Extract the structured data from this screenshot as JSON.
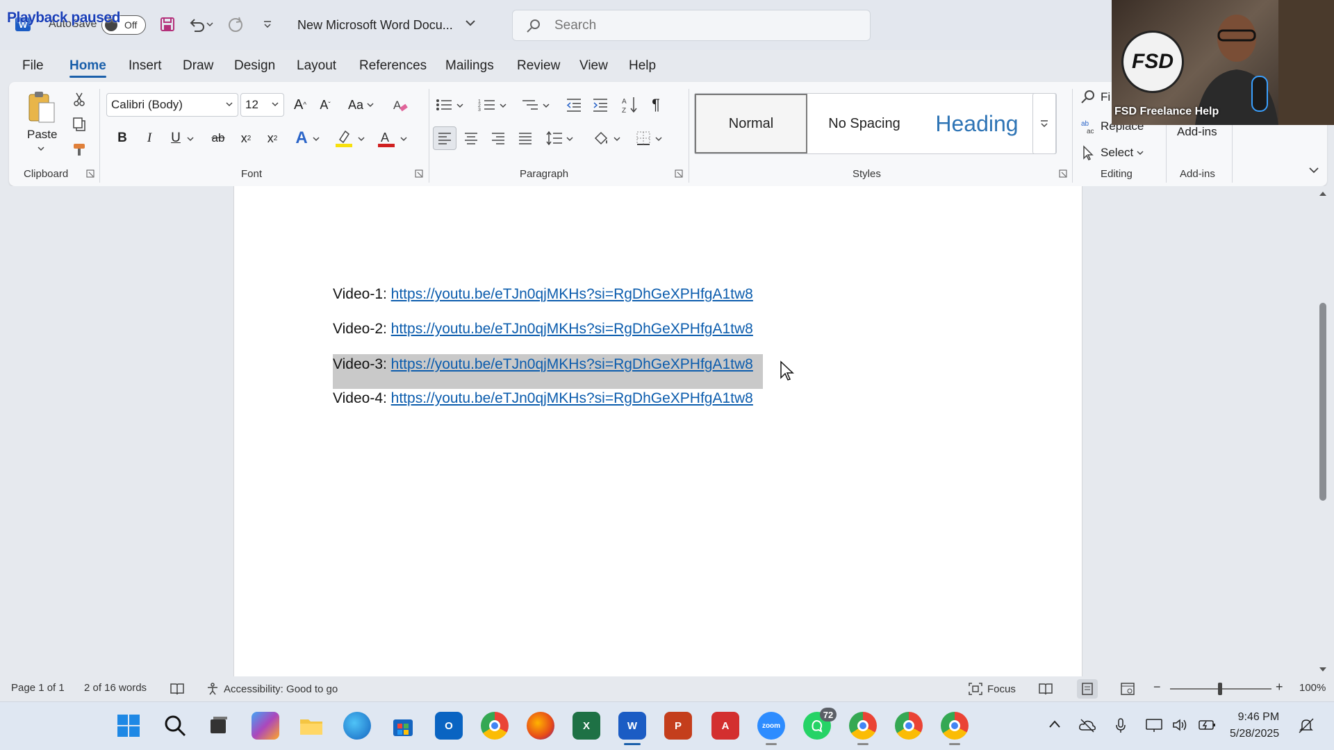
{
  "overlay": {
    "text": "Playback paused"
  },
  "titlebar": {
    "autosave_label": "AutoSave",
    "autosave_state": "Off",
    "doc_title": "New Microsoft Word Docu...",
    "search_placeholder": "Search"
  },
  "webcam": {
    "caption": "FSD Freelance Help",
    "logo_text": "FSD"
  },
  "menu": {
    "tabs": [
      "File",
      "Home",
      "Insert",
      "Draw",
      "Design",
      "Layout",
      "References",
      "Mailings",
      "Review",
      "View",
      "Help"
    ],
    "active": "Home"
  },
  "ribbon": {
    "clipboard": {
      "paste_label": "Paste",
      "group_label": "Clipboard"
    },
    "font": {
      "font_name": "Calibri (Body)",
      "font_size": "12",
      "case_label": "Aa",
      "group_label": "Font"
    },
    "paragraph": {
      "group_label": "Paragraph"
    },
    "styles": {
      "items": [
        "Normal",
        "No Spacing",
        "Heading"
      ],
      "selected": "Normal",
      "group_label": "Styles"
    },
    "editing": {
      "find_label": "Fi",
      "replace_label": "Replace",
      "select_label": "Select",
      "group_label": "Editing"
    },
    "addins": {
      "button_label": "Add-ins",
      "group_label": "Add-ins"
    }
  },
  "document": {
    "lines": [
      {
        "label": "Video-1: ",
        "link": "https://youtu.be/eTJn0qjMKHs?si=RgDhGeXPHfgA1tw8",
        "selected": false
      },
      {
        "label": "Video-2: ",
        "link": "https://youtu.be/eTJn0qjMKHs?si=RgDhGeXPHfgA1tw8",
        "selected": false
      },
      {
        "label": "Video-3: ",
        "link": "https://youtu.be/eTJn0qjMKHs?si=RgDhGeXPHfgA1tw8",
        "selected": true
      },
      {
        "label": "Video-4: ",
        "link": "https://youtu.be/eTJn0qjMKHs?si=RgDhGeXPHfgA1tw8",
        "selected": false
      }
    ]
  },
  "status": {
    "page": "Page 1 of 1",
    "words": "2 of 16 words",
    "accessibility": "Accessibility: Good to go",
    "focus": "Focus",
    "zoom": "100%"
  },
  "taskbar": {
    "whatsapp_badge": "72",
    "time": "9:46 PM",
    "date": "5/28/2025"
  },
  "colors": {
    "accent": "#1a5faa",
    "link": "#0b5cad",
    "selection": "#c9c9c9"
  }
}
